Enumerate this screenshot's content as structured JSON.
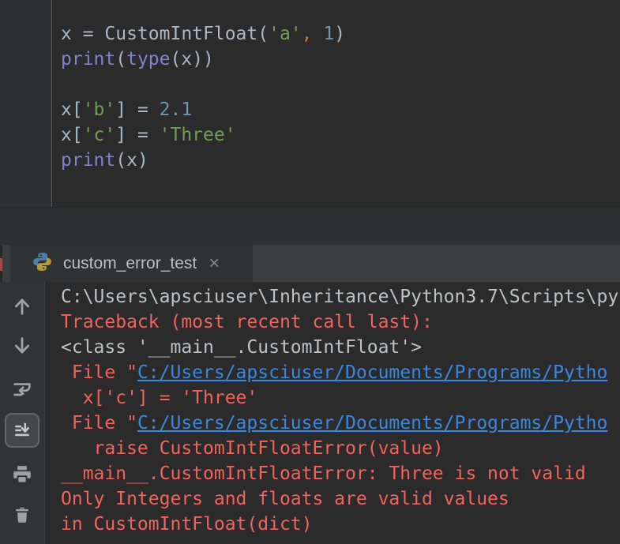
{
  "colors": {
    "editor-bg": "#2b2b2b",
    "gutter-bg": "#2f3133",
    "gutter-line": "#565a5c",
    "band-bg": "#2e3132",
    "tabrow-bg": "#3b3e40",
    "tab-bg": "#303233",
    "tab-label": "#bcbec0",
    "toolbar-bg": "#313436",
    "console-bg": "#2b2b2b",
    "code-plain": "#a9b7c6",
    "code-string": "#6f9e55",
    "code-number": "#6897bb",
    "code-comma": "#cc7832",
    "code-builtin": "#7d83cc",
    "console-plain": "#bfc1c3",
    "console-error": "#f4625e",
    "console-link": "#3b87e0",
    "python-logo-blue": "#4a7fa9",
    "python-logo-gold": "#b89b38",
    "icon-gray": "#a0a3a5"
  },
  "editor": {
    "lines": [
      {
        "tokens": [
          {
            "t": "x = CustomIntFloat(",
            "c": "plain"
          },
          {
            "t": "'a'",
            "c": "string"
          },
          {
            "t": ",",
            "c": "comma"
          },
          {
            "t": " ",
            "c": "plain"
          },
          {
            "t": "1",
            "c": "number"
          },
          {
            "t": ")",
            "c": "plain"
          }
        ]
      },
      {
        "tokens": [
          {
            "t": "print",
            "c": "builtin"
          },
          {
            "t": "(",
            "c": "plain"
          },
          {
            "t": "type",
            "c": "builtin"
          },
          {
            "t": "(x))",
            "c": "plain"
          }
        ]
      },
      {
        "tokens": []
      },
      {
        "tokens": [
          {
            "t": "x[",
            "c": "plain"
          },
          {
            "t": "'b'",
            "c": "string"
          },
          {
            "t": "] = ",
            "c": "plain"
          },
          {
            "t": "2.1",
            "c": "number"
          }
        ]
      },
      {
        "tokens": [
          {
            "t": "x[",
            "c": "plain"
          },
          {
            "t": "'c'",
            "c": "string"
          },
          {
            "t": "] = ",
            "c": "plain"
          },
          {
            "t": "'Three'",
            "c": "string"
          }
        ]
      },
      {
        "tokens": [
          {
            "t": "print",
            "c": "builtin"
          },
          {
            "t": "(x)",
            "c": "plain"
          }
        ]
      }
    ]
  },
  "run_tab": {
    "label": "custom_error_test",
    "close_glyph": "×",
    "icon": "python-logo"
  },
  "toolbar": {
    "buttons": [
      {
        "name": "up-the-stack-trace",
        "icon": "arrow-up-icon",
        "selected": false
      },
      {
        "name": "down-the-stack-trace",
        "icon": "arrow-down-icon",
        "selected": false
      },
      {
        "name": "use-soft-wraps",
        "icon": "soft-wrap-icon",
        "selected": false
      },
      {
        "name": "scroll-to-end",
        "icon": "scroll-to-end-icon",
        "selected": true
      },
      {
        "name": "print",
        "icon": "printer-icon",
        "selected": false
      },
      {
        "name": "clear-all",
        "icon": "trash-icon",
        "selected": false
      }
    ]
  },
  "console": {
    "lines": [
      {
        "spans": [
          {
            "t": "C:\\Users\\apsciuser\\Inheritance\\Python3.7\\Scripts\\py",
            "c": "plain"
          }
        ]
      },
      {
        "spans": [
          {
            "t": "Traceback (most recent call last):",
            "c": "error"
          }
        ]
      },
      {
        "spans": [
          {
            "t": "<class '__main__.CustomIntFloat'>",
            "c": "plain"
          }
        ]
      },
      {
        "spans": [
          {
            "t": " File \"",
            "c": "error"
          },
          {
            "t": "C:/Users/apsciuser/Documents/Programs/Pytho",
            "c": "link"
          }
        ]
      },
      {
        "spans": [
          {
            "t": "  x['c'] = 'Three'",
            "c": "error"
          }
        ]
      },
      {
        "spans": [
          {
            "t": " File \"",
            "c": "error"
          },
          {
            "t": "C:/Users/apsciuser/Documents/Programs/Pytho",
            "c": "link"
          }
        ]
      },
      {
        "spans": [
          {
            "t": "   raise CustomIntFloatError(value)",
            "c": "error"
          }
        ]
      },
      {
        "spans": [
          {
            "t": "__main__.CustomIntFloatError: Three is not valid",
            "c": "error"
          }
        ]
      },
      {
        "spans": [
          {
            "t": "Only Integers and floats are valid values",
            "c": "error"
          }
        ]
      },
      {
        "spans": [
          {
            "t": "in CustomIntFloat(dict)",
            "c": "error"
          }
        ]
      }
    ]
  }
}
